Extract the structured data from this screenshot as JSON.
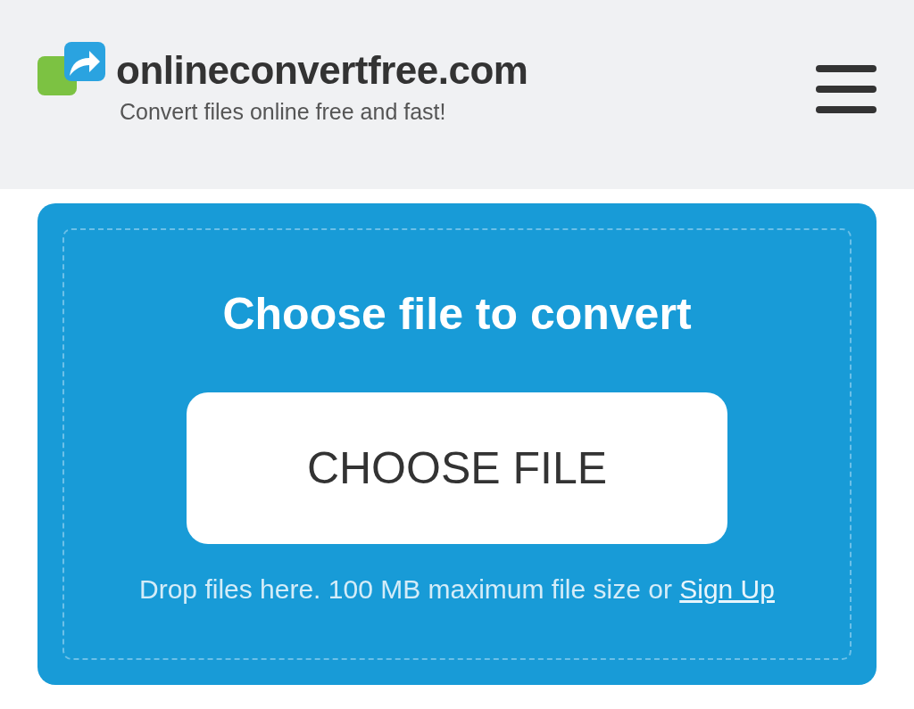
{
  "header": {
    "site_name": "onlineconvertfree.com",
    "tagline": "Convert files online free and fast!"
  },
  "upload": {
    "title": "Choose file to convert",
    "button": "CHOOSE FILE",
    "hint": "Drop files here. 100 MB maximum file size or",
    "link": "Sign Up"
  }
}
